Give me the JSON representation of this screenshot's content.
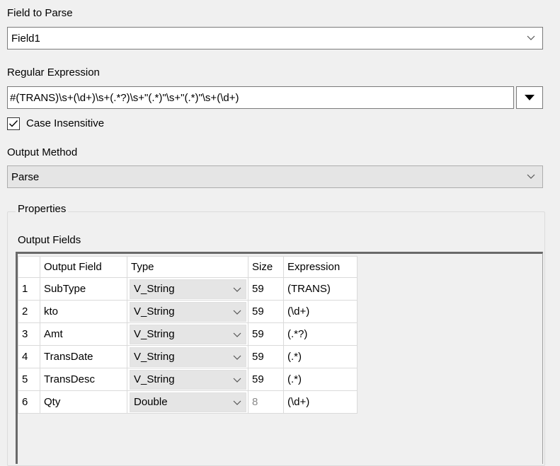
{
  "field_to_parse": {
    "label": "Field to Parse",
    "value": "Field1"
  },
  "regex": {
    "label": "Regular Expression",
    "value": "#(TRANS)\\s+(\\d+)\\s+(.*?)\\s+\"(.*)\"\\s+\"(.*)\"\\s+(\\d+)"
  },
  "case_insensitive": {
    "label": "Case Insensitive",
    "checked": true
  },
  "output_method": {
    "label": "Output Method",
    "value": "Parse"
  },
  "properties": {
    "title": "Properties",
    "output_fields_label": "Output Fields",
    "columns": [
      "",
      "Output Field",
      "Type",
      "Size",
      "Expression"
    ],
    "rows": [
      {
        "num": "1",
        "name": "SubType",
        "type": "V_String",
        "size": "59",
        "expr": "(TRANS)"
      },
      {
        "num": "2",
        "name": "kto",
        "type": "V_String",
        "size": "59",
        "expr": "(\\d+)"
      },
      {
        "num": "3",
        "name": "Amt",
        "type": "V_String",
        "size": "59",
        "expr": "(.*?)"
      },
      {
        "num": "4",
        "name": "TransDate",
        "type": "V_String",
        "size": "59",
        "expr": "(.*)"
      },
      {
        "num": "5",
        "name": "TransDesc",
        "type": "V_String",
        "size": "59",
        "expr": "(.*)"
      },
      {
        "num": "6",
        "name": "Qty",
        "type": "Double",
        "size": "8",
        "expr": "(\\d+)"
      }
    ]
  }
}
